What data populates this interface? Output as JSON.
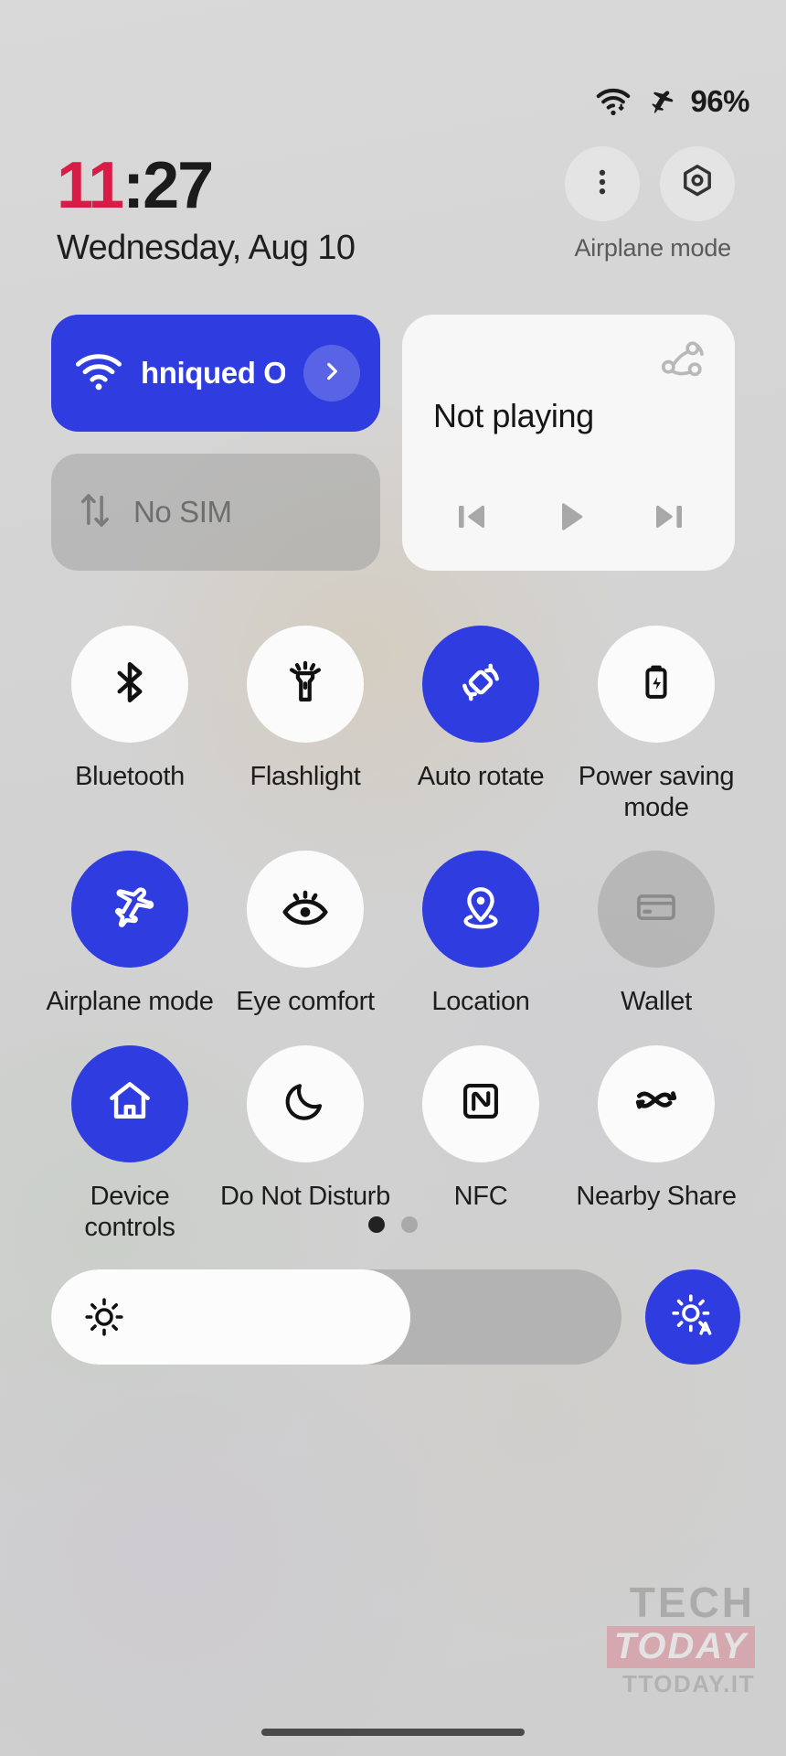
{
  "status_bar": {
    "wifi_icon": "wifi-icon",
    "airplane_icon": "airplane-icon",
    "battery_percent": "96%"
  },
  "clock": {
    "hours": "11",
    "separator": ":",
    "minutes": "27",
    "date": "Wednesday, Aug 10"
  },
  "header": {
    "overflow_icon": "more-vert-icon",
    "settings_icon": "settings-hex-icon",
    "mode_status": "Airplane mode"
  },
  "connectivity": {
    "wifi": {
      "label": "hniqued O",
      "state": "on",
      "icon": "wifi-icon",
      "chevron_icon": "chevron-right-icon"
    },
    "sim": {
      "label": "No SIM",
      "state": "disabled",
      "icon": "mobile-data-icon"
    }
  },
  "media": {
    "title": "Not playing",
    "cast_icon": "media-output-switcher-icon",
    "previous_icon": "skip-previous-icon",
    "play_icon": "play-icon",
    "next_icon": "skip-next-icon"
  },
  "tiles": [
    {
      "label": "Bluetooth",
      "icon": "bluetooth-icon",
      "state": "off"
    },
    {
      "label": "Flashlight",
      "icon": "flashlight-icon",
      "state": "off"
    },
    {
      "label": "Auto rotate",
      "icon": "auto-rotate-icon",
      "state": "on"
    },
    {
      "label": "Power saving mode",
      "icon": "battery-saver-icon",
      "state": "off"
    },
    {
      "label": "Airplane mode",
      "icon": "airplane-icon",
      "state": "on"
    },
    {
      "label": "Eye comfort",
      "icon": "eye-comfort-icon",
      "state": "off"
    },
    {
      "label": "Location",
      "icon": "location-pin-icon",
      "state": "on"
    },
    {
      "label": "Wallet",
      "icon": "wallet-card-icon",
      "state": "dim"
    },
    {
      "label": "Device controls",
      "icon": "home-icon",
      "state": "on"
    },
    {
      "label": "Do Not Disturb",
      "icon": "moon-icon",
      "state": "off"
    },
    {
      "label": "NFC",
      "icon": "nfc-icon",
      "state": "off"
    },
    {
      "label": "Nearby Share",
      "icon": "nearby-share-icon",
      "state": "off"
    }
  ],
  "pagination": {
    "total": 2,
    "current": 1
  },
  "brightness": {
    "level_percent": 63,
    "slider_icon": "brightness-sun-icon",
    "auto_icon": "brightness-auto-icon",
    "auto_state": "on"
  },
  "watermark": {
    "line1": "TECH",
    "line2": "TODAY",
    "line3": "TTODAY.IT"
  },
  "colors": {
    "accent_blue": "#2f3ce0",
    "clock_red": "#d81b47",
    "background": "#d4d4d4",
    "tile_off": "#fbfbfb",
    "tile_dim": "#969696"
  }
}
